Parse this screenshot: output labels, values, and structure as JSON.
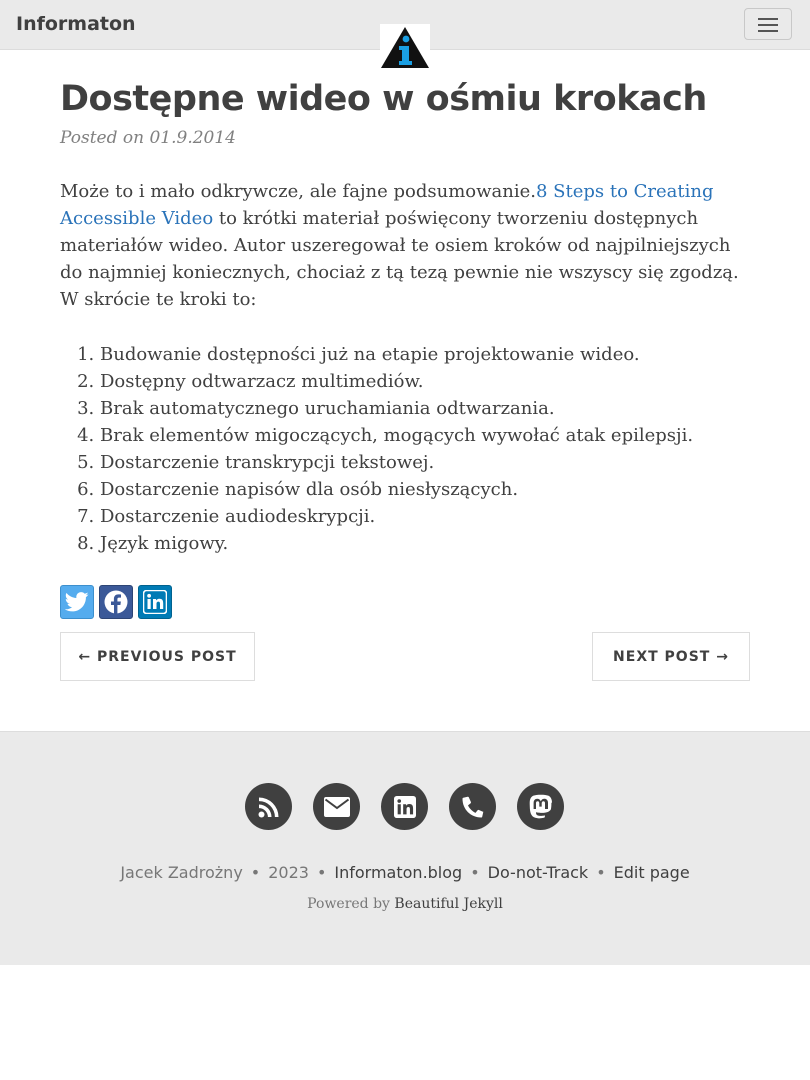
{
  "navbar": {
    "brand": "Informaton"
  },
  "post": {
    "title": "Dostępne wideo w ośmiu krokach",
    "meta": "Posted on 01.9.2014",
    "intro_before": "Może to i mało odkrywcze, ale fajne podsumowanie.",
    "intro_link": "8 Steps to Creating Accessible Video",
    "intro_after": " to krótki materiał poświęcony tworzeniu dostępnych materiałów wideo. Autor uszeregował te osiem kroków od najpilniejszych do najmniej koniecznych, chociaż z tą tezą pewnie nie wszyscy się zgodzą. W skrócie te kroki to:",
    "steps": [
      "Budowanie dostępności już na etapie projektowanie wideo.",
      "Dostępny odtwarzacz multimediów.",
      "Brak automatycznego uruchamiania odtwarzania.",
      "Brak elementów migoczących, mogących wywołać atak epilepsji.",
      "Dostarczenie transkrypcji tekstowej.",
      "Dostarczenie napisów dla osób niesłyszących.",
      "Dostarczenie audiodeskrypcji.",
      "Język migowy."
    ]
  },
  "share": [
    "twitter-icon",
    "facebook-icon",
    "linkedin-icon"
  ],
  "pager": {
    "prev": "← PREVIOUS POST",
    "next": "NEXT POST →"
  },
  "footer": {
    "icons": [
      "rss-icon",
      "envelope-icon",
      "linkedin-icon",
      "phone-icon",
      "mastodon-icon"
    ],
    "author": "Jacek Zadrożny",
    "year": "2023",
    "site": "Informaton.blog",
    "dnt": "Do-not-Track",
    "edit": "Edit page",
    "powered_by": "Powered by",
    "powered_link": "Beautiful Jekyll"
  },
  "colors": {
    "link": "#2a73b9",
    "navbar_bg": "#eaeaea",
    "footer_bg": "#eaeaea",
    "twitter": "#55acee",
    "facebook": "#3b5998",
    "linkedin": "#007bb5"
  }
}
